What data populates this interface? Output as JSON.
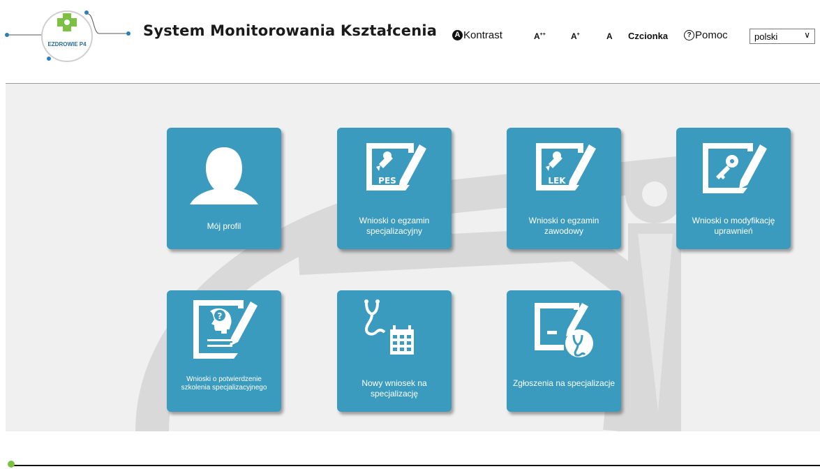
{
  "header": {
    "logo_text": "EZDROWIE P4",
    "title": "System Monitorowania Kształcenia",
    "kontrast_label": "Kontrast",
    "kontrast_glyph": "A",
    "font_large": "A",
    "font_large_sup": "++",
    "font_medium": "A",
    "font_medium_sup": "+",
    "font_normal": "A",
    "czcionka_label": "Czcionka",
    "pomoc_label": "Pomoc",
    "pomoc_glyph": "?",
    "language": "polski",
    "chevron": "∨"
  },
  "tiles": [
    {
      "label": "Mój profil",
      "icon": "user-silhouette-icon"
    },
    {
      "label": "Wnioski o egzamin specjalizacyjny",
      "badge": "PES",
      "icon": "pes-form-icon"
    },
    {
      "label": "Wnioski o egzamin zawodowy",
      "badge": "LEK",
      "icon": "lek-form-icon"
    },
    {
      "label": "Wnioski o modyfikację uprawnień",
      "icon": "key-form-icon"
    },
    {
      "label": "Wnioski o potwierdzenie szkolenia specjalizacyjnego",
      "badge": "?",
      "icon": "head-question-form-icon"
    },
    {
      "label": "Nowy wniosek na specjalizację",
      "icon": "stethoscope-calendar-icon"
    },
    {
      "label": "Zgłoszenia na specjalizacje",
      "icon": "form-stethoscope-icon"
    }
  ],
  "colors": {
    "tile": "#3a9bbf",
    "logo_green": "#7cc144",
    "logo_blue": "#2a7fb8",
    "background": "#f0f0f0"
  }
}
